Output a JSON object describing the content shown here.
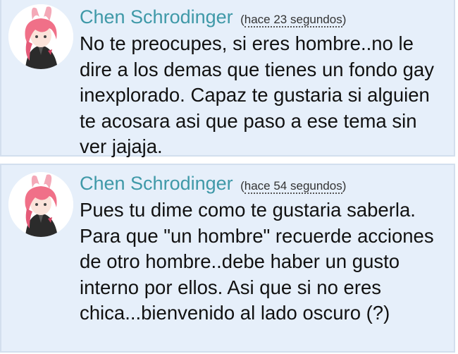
{
  "comments": [
    {
      "author": "Chen Schrodinger",
      "time_open": "(",
      "timestamp": "hace 23 segundos",
      "time_close": ")",
      "text": "No te preocupes, si eres hombre..no le dire a los demas que tienes un fondo gay inexplorado. Capaz te gustaria si alguien te acosara asi que paso a ese tema sin ver jajaja."
    },
    {
      "author": "Chen Schrodinger",
      "time_open": "(",
      "timestamp": "hace 54 segundos",
      "time_close": ")",
      "text": "Pues tu dime como te gustaria saberla. Para que \"un hombre\" recuerde acciones de otro hombre..debe haber un gusto interno por ellos. Asi que si no eres chica...bienvenido al lado oscuro (?)"
    }
  ],
  "colors": {
    "author": "#3f99a8",
    "background": "#e6effa",
    "border": "#d3dfee",
    "hair": "#f07088"
  }
}
